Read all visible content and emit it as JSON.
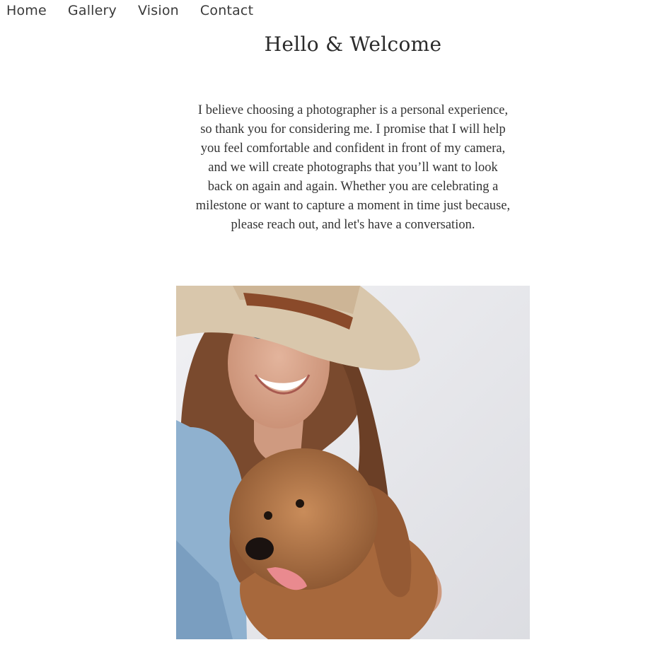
{
  "nav": {
    "items": [
      {
        "label": "Home"
      },
      {
        "label": "Gallery"
      },
      {
        "label": "Vision"
      },
      {
        "label": "Contact"
      }
    ]
  },
  "page": {
    "title": "Hello & Welcome",
    "intro": "I believe choosing a photographer is a personal experience, so thank you for considering me. I promise that I will help you feel comfortable and confident in front of my camera, and we will create photographs that you’ll want to look back on again and again. Whether you are celebrating a milestone or want to capture a moment in time just because, please reach out, and let's have a conversation."
  },
  "colors": {
    "text": "#2a2a2a",
    "background": "#ffffff"
  }
}
